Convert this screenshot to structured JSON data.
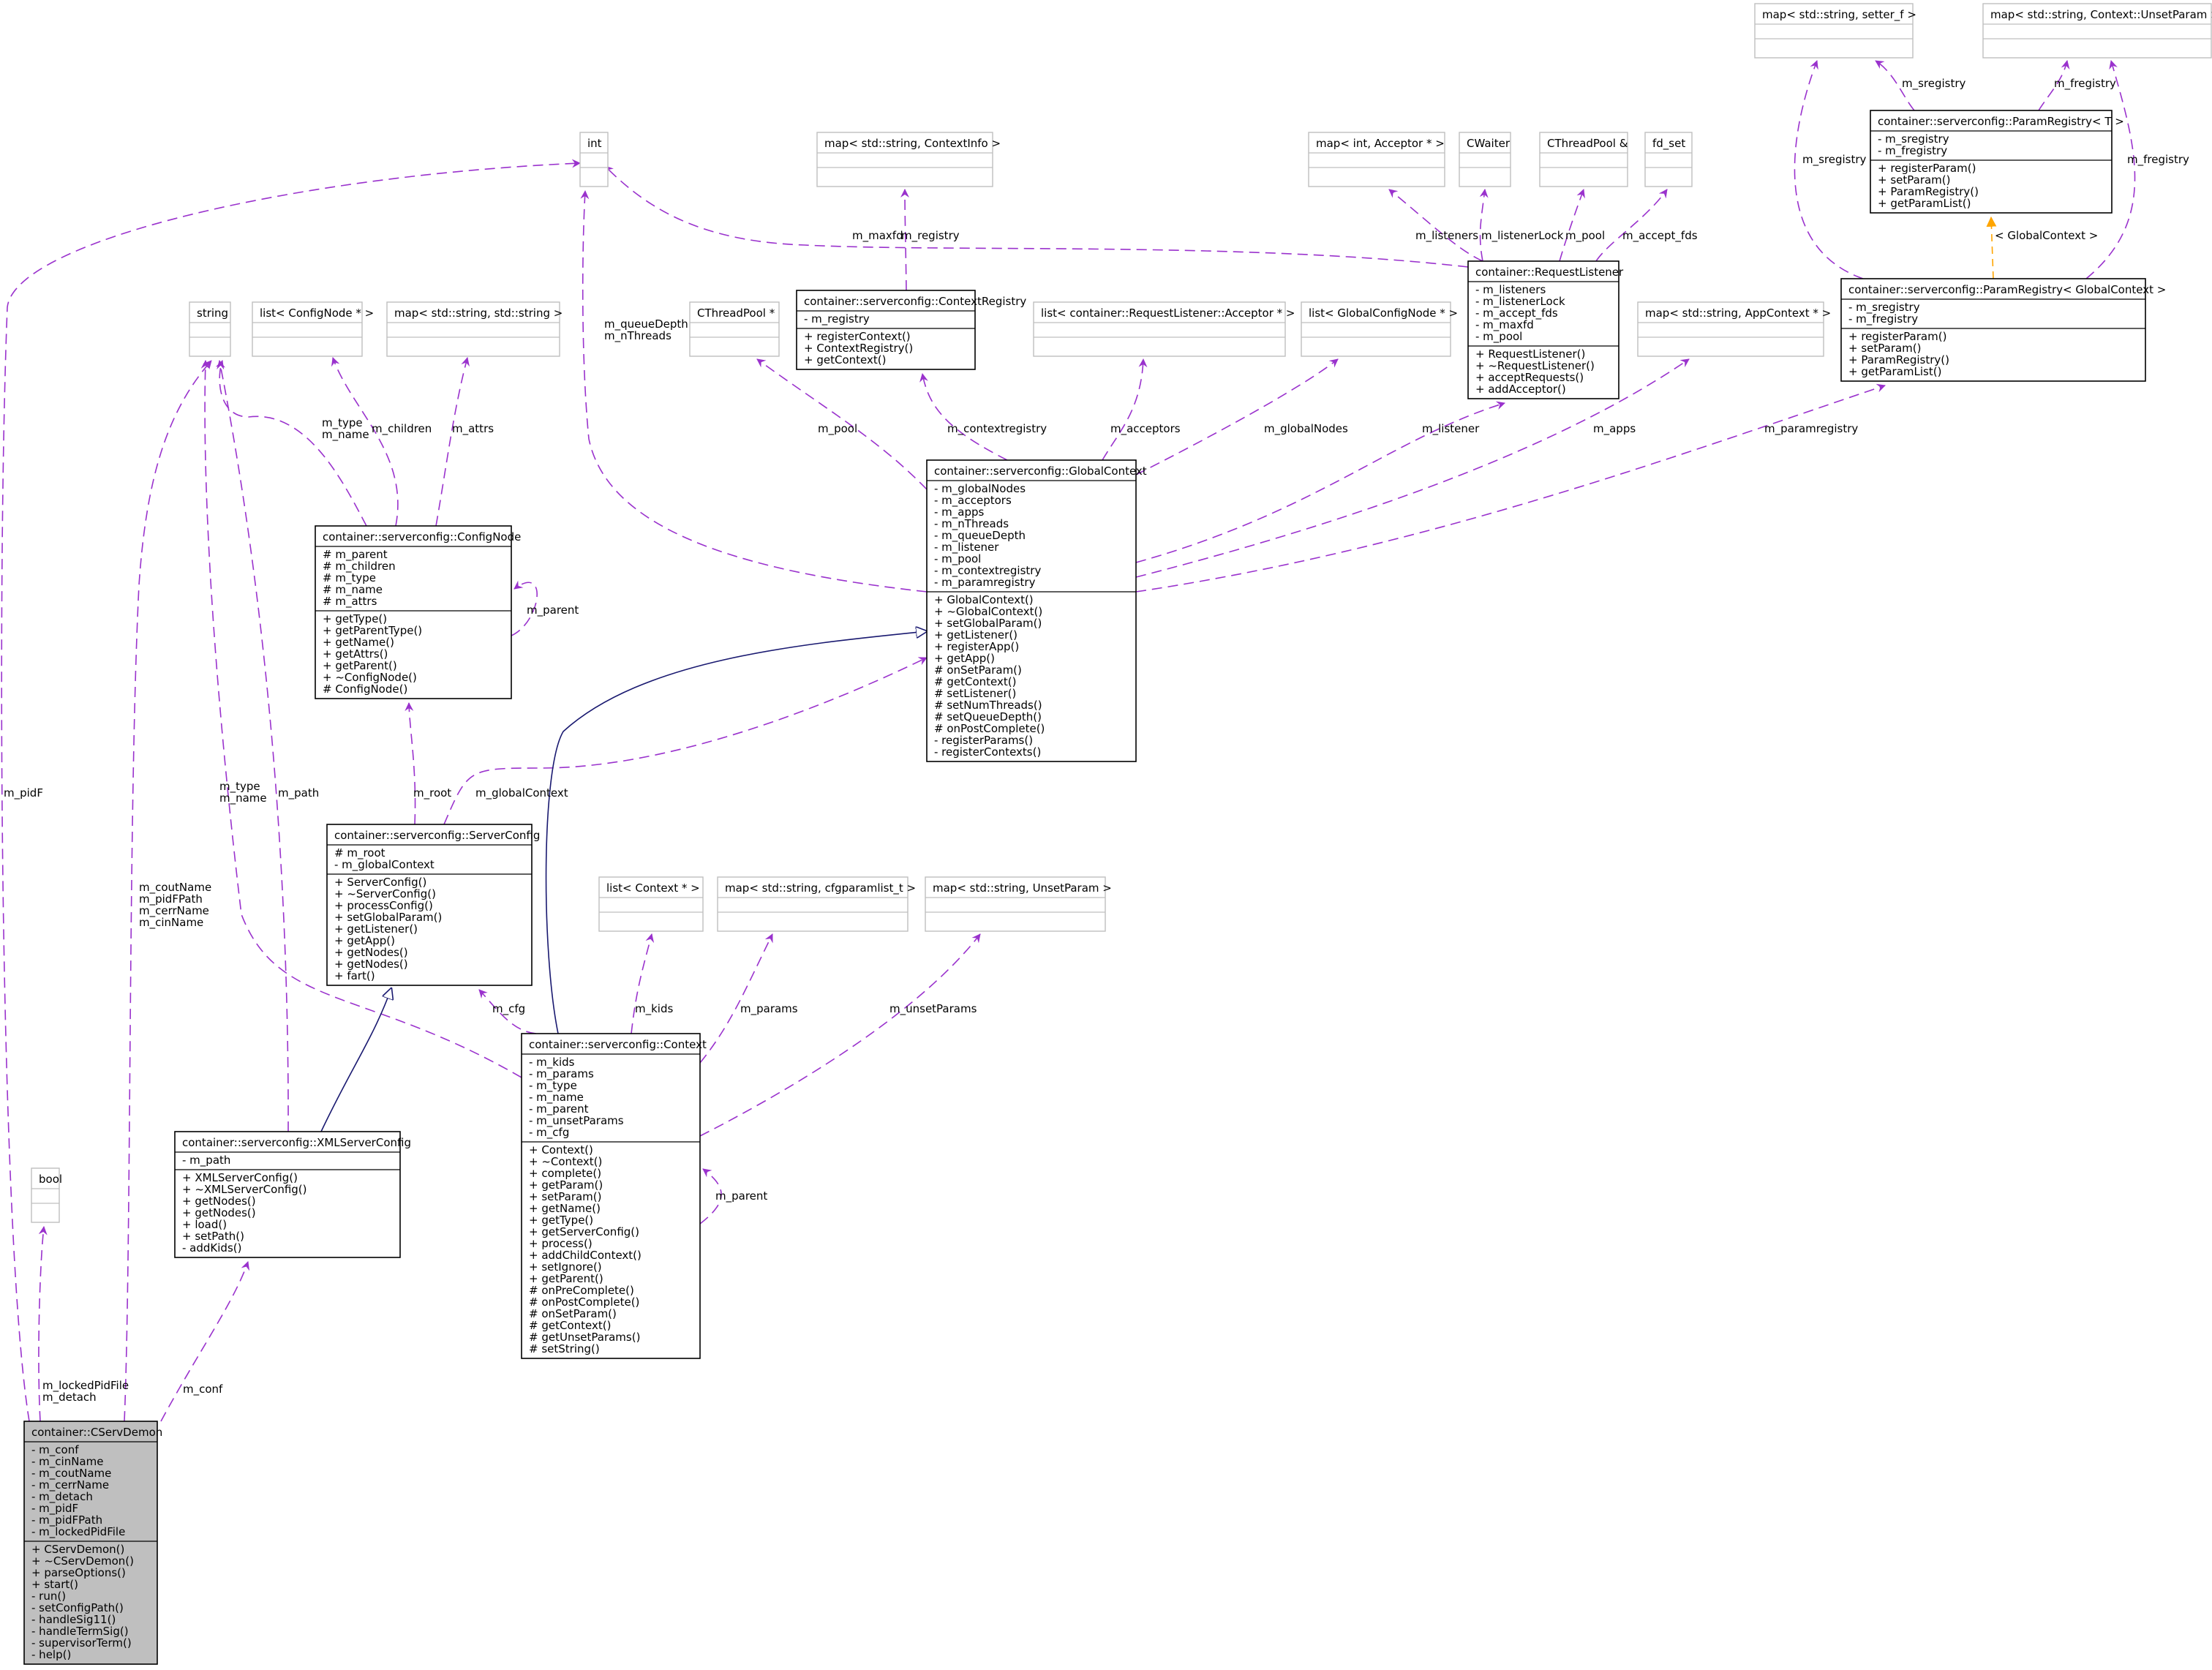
{
  "colors": {
    "usage_edge": "#9a32cd",
    "inherit_edge": "#191970",
    "template_edge": "#ffa500",
    "external_border": "#bfbfbf",
    "focus_fill": "#bfbfbf"
  },
  "nodes": {
    "int": {
      "title": "int",
      "attrs": [],
      "methods": [],
      "kind": "external"
    },
    "bool": {
      "title": "bool",
      "attrs": [],
      "methods": [],
      "kind": "external"
    },
    "string": {
      "title": "string",
      "attrs": [],
      "methods": [],
      "kind": "external"
    },
    "list_confignode": {
      "title": "list< ConfigNode * >",
      "attrs": [],
      "methods": [],
      "kind": "external"
    },
    "map_str_str": {
      "title": "map< std::string, std::string >",
      "attrs": [],
      "methods": [],
      "kind": "external"
    },
    "cthreadpool_ptr": {
      "title": "CThreadPool *",
      "attrs": [],
      "methods": [],
      "kind": "external"
    },
    "map_str_contextinfo": {
      "title": "map< std::string, ContextInfo >",
      "attrs": [],
      "methods": [],
      "kind": "external"
    },
    "list_acceptor": {
      "title": "list< container::RequestListener::Acceptor * >",
      "attrs": [],
      "methods": [],
      "kind": "external"
    },
    "list_globalconfignode": {
      "title": "list< GlobalConfigNode * >",
      "attrs": [],
      "methods": [],
      "kind": "external"
    },
    "map_int_acceptor": {
      "title": "map< int, Acceptor * >",
      "attrs": [],
      "methods": [],
      "kind": "external"
    },
    "cwaiter": {
      "title": "CWaiter",
      "attrs": [],
      "methods": [],
      "kind": "external"
    },
    "cthreadpool_ref": {
      "title": "CThreadPool &",
      "attrs": [],
      "methods": [],
      "kind": "external"
    },
    "fd_set": {
      "title": "fd_set",
      "attrs": [],
      "methods": [],
      "kind": "external"
    },
    "map_str_appcontext": {
      "title": "map< std::string, AppContext * >",
      "attrs": [],
      "methods": [],
      "kind": "external"
    },
    "map_str_setter": {
      "title": "map< std::string, setter_f >",
      "attrs": [],
      "methods": [],
      "kind": "external"
    },
    "map_str_unsetparam_ctx": {
      "title": "map< std::string, Context::UnsetParam >",
      "attrs": [],
      "methods": [],
      "kind": "external"
    },
    "list_context": {
      "title": "list< Context * >",
      "attrs": [],
      "methods": [],
      "kind": "external"
    },
    "map_str_cfgparamlist": {
      "title": "map< std::string, cfgparamlist_t >",
      "attrs": [],
      "methods": [],
      "kind": "external"
    },
    "map_str_unsetparam": {
      "title": "map< std::string, UnsetParam >",
      "attrs": [],
      "methods": [],
      "kind": "external"
    },
    "paramregistry_t": {
      "title": "container::serverconfig::ParamRegistry< T >",
      "attrs": [
        "- m_sregistry",
        "- m_fregistry"
      ],
      "methods": [
        "+ registerParam()",
        "+ setParam()",
        "+ ParamRegistry()",
        "+ getParamList()"
      ],
      "kind": "class"
    },
    "paramregistry_gc": {
      "title": "container::serverconfig::ParamRegistry< GlobalContext >",
      "attrs": [
        "- m_sregistry",
        "- m_fregistry"
      ],
      "methods": [
        "+ registerParam()",
        "+ setParam()",
        "+ ParamRegistry()",
        "+ getParamList()"
      ],
      "kind": "class"
    },
    "contextregistry": {
      "title": "container::serverconfig::ContextRegistry",
      "attrs": [
        "- m_registry"
      ],
      "methods": [
        "+ registerContext()",
        "+ ContextRegistry()",
        "+ getContext()"
      ],
      "kind": "class"
    },
    "requestlistener": {
      "title": "container::RequestListener",
      "attrs": [
        "- m_listeners",
        "- m_listenerLock",
        "- m_accept_fds",
        "- m_maxfd",
        "- m_pool"
      ],
      "methods": [
        "+ RequestListener()",
        "+ ~RequestListener()",
        "+ acceptRequests()",
        "+ addAcceptor()"
      ],
      "kind": "class"
    },
    "confignode": {
      "title": "container::serverconfig::ConfigNode",
      "attrs": [
        "# m_parent",
        "# m_children",
        "# m_type",
        "# m_name",
        "# m_attrs"
      ],
      "methods": [
        "+ getType()",
        "+ getParentType()",
        "+ getName()",
        "+ getAttrs()",
        "+ getParent()",
        "+ ~ConfigNode()",
        "# ConfigNode()"
      ],
      "kind": "class"
    },
    "globalcontext": {
      "title": "container::serverconfig::GlobalContext",
      "attrs": [
        "- m_globalNodes",
        "- m_acceptors",
        "- m_apps",
        "- m_nThreads",
        "- m_queueDepth",
        "- m_listener",
        "- m_pool",
        "- m_contextregistry",
        "- m_paramregistry"
      ],
      "methods": [
        "+ GlobalContext()",
        "+ ~GlobalContext()",
        "+ setGlobalParam()",
        "+ getListener()",
        "+ registerApp()",
        "+ getApp()",
        "# onSetParam()",
        "# getContext()",
        "# setListener()",
        "# setNumThreads()",
        "# setQueueDepth()",
        "# onPostComplete()",
        "- registerParams()",
        "- registerContexts()"
      ],
      "kind": "class"
    },
    "serverconfig": {
      "title": "container::serverconfig::ServerConfig",
      "attrs": [
        "# m_root",
        "- m_globalContext"
      ],
      "methods": [
        "+ ServerConfig()",
        "+ ~ServerConfig()",
        "+ processConfig()",
        "+ setGlobalParam()",
        "+ getListener()",
        "+ getApp()",
        "+ getNodes()",
        "+ getNodes()",
        "+ fart()"
      ],
      "kind": "class"
    },
    "xmlserverconfig": {
      "title": "container::serverconfig::XMLServerConfig",
      "attrs": [
        "- m_path"
      ],
      "methods": [
        "+ XMLServerConfig()",
        "+ ~XMLServerConfig()",
        "+ getNodes()",
        "+ getNodes()",
        "+ load()",
        "+ setPath()",
        "- addKids()"
      ],
      "kind": "class"
    },
    "context": {
      "title": "container::serverconfig::Context",
      "attrs": [
        "- m_kids",
        "- m_params",
        "- m_type",
        "- m_name",
        "- m_parent",
        "- m_unsetParams",
        "- m_cfg"
      ],
      "methods": [
        "+ Context()",
        "+ ~Context()",
        "+ complete()",
        "+ getParam()",
        "+ setParam()",
        "+ getName()",
        "+ getType()",
        "+ getServerConfig()",
        "+ process()",
        "+ addChildContext()",
        "+ setIgnore()",
        "+ getParent()",
        "# onPreComplete()",
        "# onPostComplete()",
        "# onSetParam()",
        "# getContext()",
        "# getUnsetParams()",
        "# setString()"
      ],
      "kind": "class"
    },
    "cservdemon": {
      "title": "container::CServDemon",
      "attrs": [
        "- m_conf",
        "- m_cinName",
        "- m_coutName",
        "- m_cerrName",
        "- m_detach",
        "- m_pidF",
        "- m_pidFPath",
        "- m_lockedPidFile"
      ],
      "methods": [
        "+ CServDemon()",
        "+ ~CServDemon()",
        "+ parseOptions()",
        "+ start()",
        "- run()",
        "- setConfigPath()",
        "- handleSig11()",
        "- handleTermSig()",
        "- supervisorTerm()",
        "- help()"
      ],
      "kind": "focus"
    }
  },
  "edge_labels": {
    "m_pidF": [
      "m_pidF"
    ],
    "m_lockedpid": [
      "m_lockedPidFile",
      "m_detach"
    ],
    "m_coutname": [
      "m_coutName",
      "m_pidFPath",
      "m_cerrName",
      "m_cinName"
    ],
    "m_conf": [
      "m_conf"
    ],
    "cd_string_typename": [
      "m_type",
      "m_name"
    ],
    "cn_string": [
      "m_type",
      "m_name"
    ],
    "m_children": [
      "m_children"
    ],
    "m_attrs": [
      "m_attrs"
    ],
    "m_parent_cn": [
      "m_parent"
    ],
    "m_path": [
      "m_path"
    ],
    "m_root": [
      "m_root"
    ],
    "m_globalcontext": [
      "m_globalContext"
    ],
    "m_cfg": [
      "m_cfg"
    ],
    "m_kids": [
      "m_kids"
    ],
    "m_params": [
      "m_params"
    ],
    "m_unsetparams": [
      "m_unsetParams"
    ],
    "m_parent_ctx": [
      "m_parent"
    ],
    "m_queuedepth": [
      "m_queueDepth",
      "m_nThreads"
    ],
    "m_pool_gc": [
      "m_pool"
    ],
    "m_contextregistry": [
      "m_contextregistry"
    ],
    "m_acceptors": [
      "m_acceptors"
    ],
    "m_globalnodes": [
      "m_globalNodes"
    ],
    "m_listener": [
      "m_listener"
    ],
    "m_apps": [
      "m_apps"
    ],
    "m_paramregistry": [
      "m_paramregistry"
    ],
    "m_maxfd": [
      "m_maxfd"
    ],
    "m_registry": [
      "m_registry"
    ],
    "m_listeners": [
      "m_listeners"
    ],
    "m_listenerlock": [
      "m_listenerLock"
    ],
    "m_pool_rl": [
      "m_pool"
    ],
    "m_accept_fds": [
      "m_accept_fds"
    ],
    "m_sregistry_t": [
      "m_sregistry"
    ],
    "m_fregistry_t": [
      "m_fregistry"
    ],
    "m_sregistry_gc": [
      "m_sregistry"
    ],
    "m_fregistry_gc": [
      "m_fregistry"
    ],
    "template_arg": [
      "< GlobalContext >"
    ]
  }
}
